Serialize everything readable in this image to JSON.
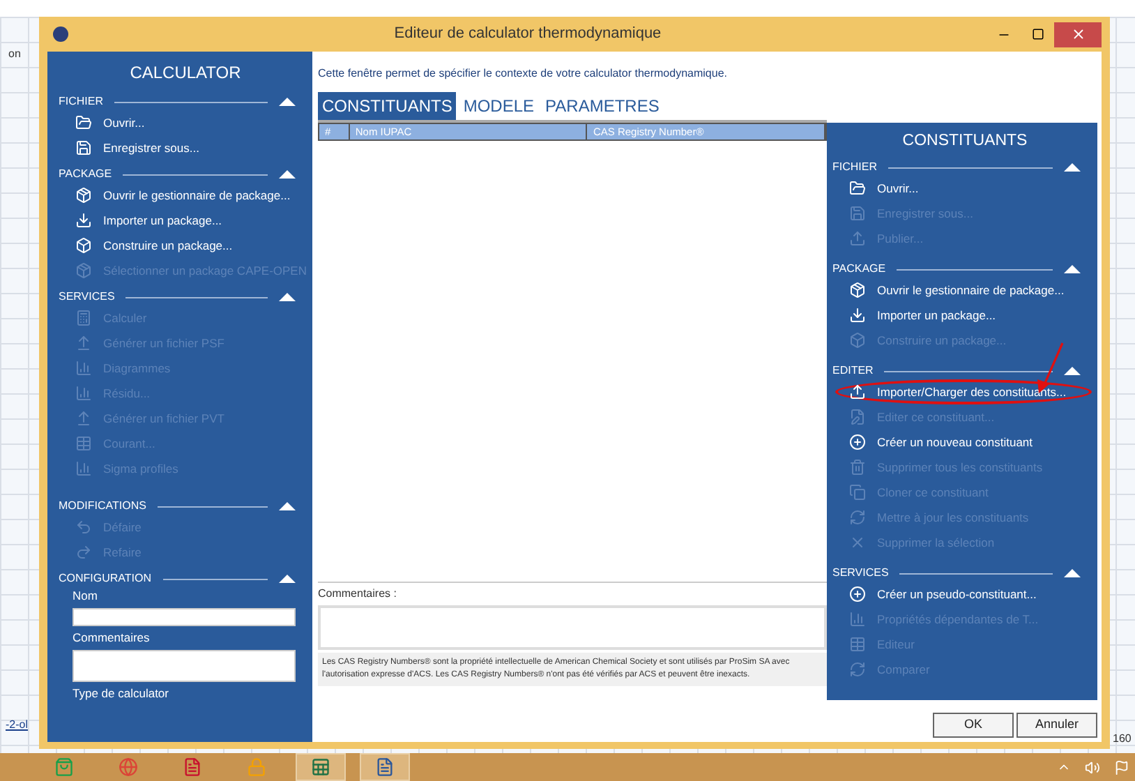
{
  "background_texts": [
    "on",
    "-2-ol",
    "160"
  ],
  "window": {
    "title": "Editeur de calculator thermodynamique"
  },
  "left_panel": {
    "title": "CALCULATOR",
    "sections": [
      {
        "title": "FICHIER",
        "expanded": true,
        "items": [
          {
            "label": "Ouvrir...",
            "disabled": false
          },
          {
            "label": "Enregistrer sous...",
            "disabled": false
          }
        ]
      },
      {
        "title": "PACKAGE",
        "expanded": true,
        "items": [
          {
            "label": "Ouvrir le gestionnaire de package...",
            "disabled": false
          },
          {
            "label": "Importer un package...",
            "disabled": false
          },
          {
            "label": "Construire un package...",
            "disabled": false
          },
          {
            "label": "Sélectionner un package CAPE-OPEN",
            "disabled": true
          }
        ]
      },
      {
        "title": "SERVICES",
        "expanded": true,
        "items": [
          {
            "label": "Calculer",
            "disabled": true
          },
          {
            "label": "Générer un fichier PSF",
            "disabled": true
          },
          {
            "label": "Diagrammes",
            "disabled": true
          },
          {
            "label": "Résidu...",
            "disabled": true
          },
          {
            "label": "Générer un fichier PVT",
            "disabled": true
          },
          {
            "label": "Courant...",
            "disabled": true
          },
          {
            "label": "Sigma profiles",
            "disabled": true
          }
        ]
      },
      {
        "title": "MODIFICATIONS",
        "expanded": true,
        "items": [
          {
            "label": "Défaire",
            "disabled": true
          },
          {
            "label": "Refaire",
            "disabled": true
          }
        ]
      }
    ],
    "configuration": {
      "title": "CONFIGURATION",
      "expanded": true,
      "name_label": "Nom",
      "comments_label": "Commentaires",
      "type_label": "Type de calculator"
    }
  },
  "center": {
    "description": "Cette fenêtre permet de spécifier le contexte de votre calculator thermodynamique.",
    "tabs": [
      {
        "label": "CONSTITUANTS",
        "selected": true
      },
      {
        "label": "MODELE",
        "selected": false
      },
      {
        "label": "PARAMETRES",
        "selected": false
      }
    ],
    "table": {
      "columns": [
        "#",
        "Nom IUPAC",
        "CAS Registry Number®"
      ]
    },
    "comments_label": "Commentaires :",
    "note": "Les CAS Registry Numbers® sont la propriété intellectuelle de American Chemical Society et sont utilisés par ProSim SA avec l'autorisation expresse d'ACS. Les CAS Registry Numbers® n'ont pas été vérifiés par ACS et peuvent être inexacts."
  },
  "right_panel": {
    "title": "CONSTITUANTS",
    "sections": [
      {
        "title": "FICHIER",
        "expanded": true,
        "items": [
          {
            "label": "Ouvrir...",
            "disabled": false,
            "annotated": false
          },
          {
            "label": "Enregistrer sous...",
            "disabled": true,
            "annotated": false
          },
          {
            "label": "Publier...",
            "disabled": true,
            "annotated": false
          }
        ]
      },
      {
        "title": "PACKAGE",
        "expanded": true,
        "items": [
          {
            "label": "Ouvrir le gestionnaire de package...",
            "disabled": false,
            "annotated": false
          },
          {
            "label": "Importer un package...",
            "disabled": false,
            "annotated": false
          },
          {
            "label": "Construire un package...",
            "disabled": true,
            "annotated": false
          }
        ]
      },
      {
        "title": "EDITER",
        "expanded": true,
        "items": [
          {
            "label": "Importer/Charger des constituants...",
            "disabled": false,
            "annotated": true
          },
          {
            "label": "Editer ce constituant...",
            "disabled": true,
            "annotated": false
          },
          {
            "label": "Créer un nouveau constituant",
            "disabled": false,
            "annotated": false
          },
          {
            "label": "Supprimer tous les constituants",
            "disabled": true,
            "annotated": false
          },
          {
            "label": "Cloner ce constituant",
            "disabled": true,
            "annotated": false
          },
          {
            "label": "Mettre à jour les constituants",
            "disabled": true,
            "annotated": false
          },
          {
            "label": "Supprimer la sélection",
            "disabled": true,
            "annotated": false
          }
        ]
      },
      {
        "title": "SERVICES",
        "expanded": true,
        "items": [
          {
            "label": "Créer un pseudo-constituant...",
            "disabled": false,
            "annotated": false
          },
          {
            "label": "Propriétés dépendantes de T...",
            "disabled": true,
            "annotated": false
          },
          {
            "label": "Editeur",
            "disabled": true,
            "annotated": false
          },
          {
            "label": "Comparer",
            "disabled": true,
            "annotated": false
          }
        ]
      }
    ]
  },
  "buttons": [
    "OK",
    "Annuler"
  ],
  "taskbar": [
    {
      "running": false
    },
    {
      "running": false
    },
    {
      "running": false
    },
    {
      "running": false
    },
    {
      "running": true
    },
    {
      "running": true
    }
  ]
}
